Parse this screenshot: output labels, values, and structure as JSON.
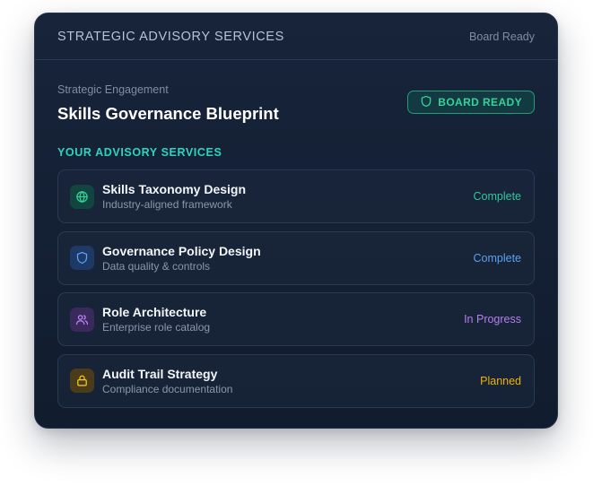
{
  "header": {
    "title": "STRATEGIC ADVISORY SERVICES",
    "status": "Board Ready"
  },
  "engagement": {
    "label": "Strategic Engagement",
    "title": "Skills Governance Blueprint",
    "badge": "BOARD READY"
  },
  "section_label": "YOUR ADVISORY SERVICES",
  "services": [
    {
      "name": "Skills Taxonomy Design",
      "description": "Industry-aligned framework",
      "status": "Complete",
      "icon": "globe-icon",
      "status_color": "#2fc79b",
      "icon_color": "#34d399",
      "icon_bg": "#12453f"
    },
    {
      "name": "Governance Policy Design",
      "description": "Data quality & controls",
      "status": "Complete",
      "icon": "shield-icon",
      "status_color": "#5aa0f2",
      "icon_color": "#60a5fa",
      "icon_bg": "#1d3a66"
    },
    {
      "name": "Role Architecture",
      "description": "Enterprise role catalog",
      "status": "In Progress",
      "icon": "users-icon",
      "status_color": "#b57ef0",
      "icon_color": "#c084fc",
      "icon_bg": "#3a2a5c"
    },
    {
      "name": "Audit Trail Strategy",
      "description": "Compliance documentation",
      "status": "Planned",
      "icon": "lock-icon",
      "status_color": "#eab308",
      "icon_color": "#facc15",
      "icon_bg": "#4a3c1a"
    }
  ],
  "colors": {
    "accent": "#2dd4bf",
    "badge_green": "#34d399",
    "card_bg": "#17243a"
  }
}
